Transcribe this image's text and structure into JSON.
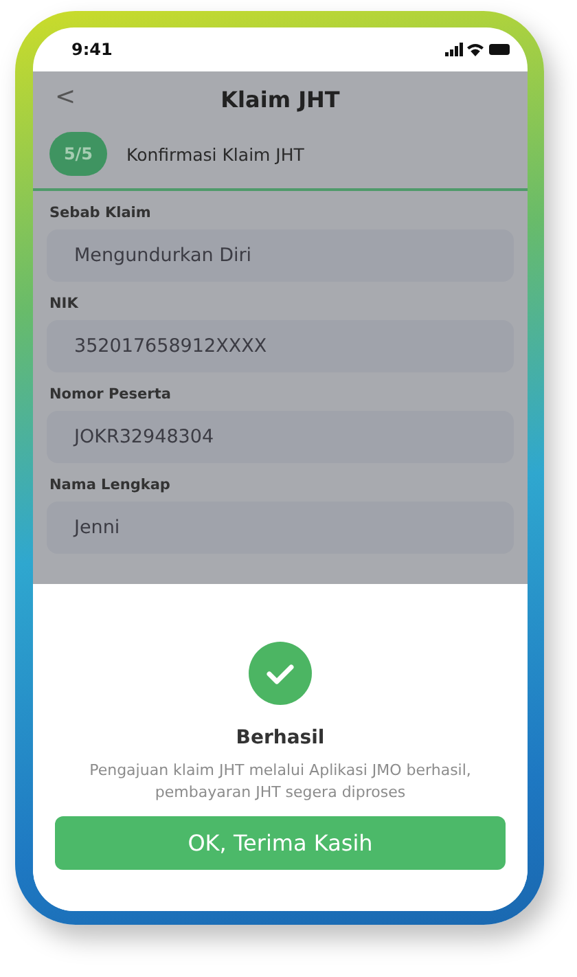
{
  "status_bar": {
    "time": "9:41"
  },
  "header": {
    "back": "<",
    "title": "Klaim JHT"
  },
  "step": {
    "badge": "5/5",
    "label": "Konfirmasi Klaim JHT"
  },
  "fields": [
    {
      "label": "Sebab Klaim",
      "value": "Mengundurkan Diri"
    },
    {
      "label": "NIK",
      "value": "352017658912XXXX"
    },
    {
      "label": "Nomor Peserta",
      "value": "JOKR32948304"
    },
    {
      "label": "Nama Lengkap",
      "value": "Jenni"
    }
  ],
  "dialog": {
    "title": "Berhasil",
    "message": "Pengajuan klaim JHT melalui Aplikasi JMO berhasil, pembayaran JHT segera diproses",
    "button": "OK, Terima Kasih"
  }
}
